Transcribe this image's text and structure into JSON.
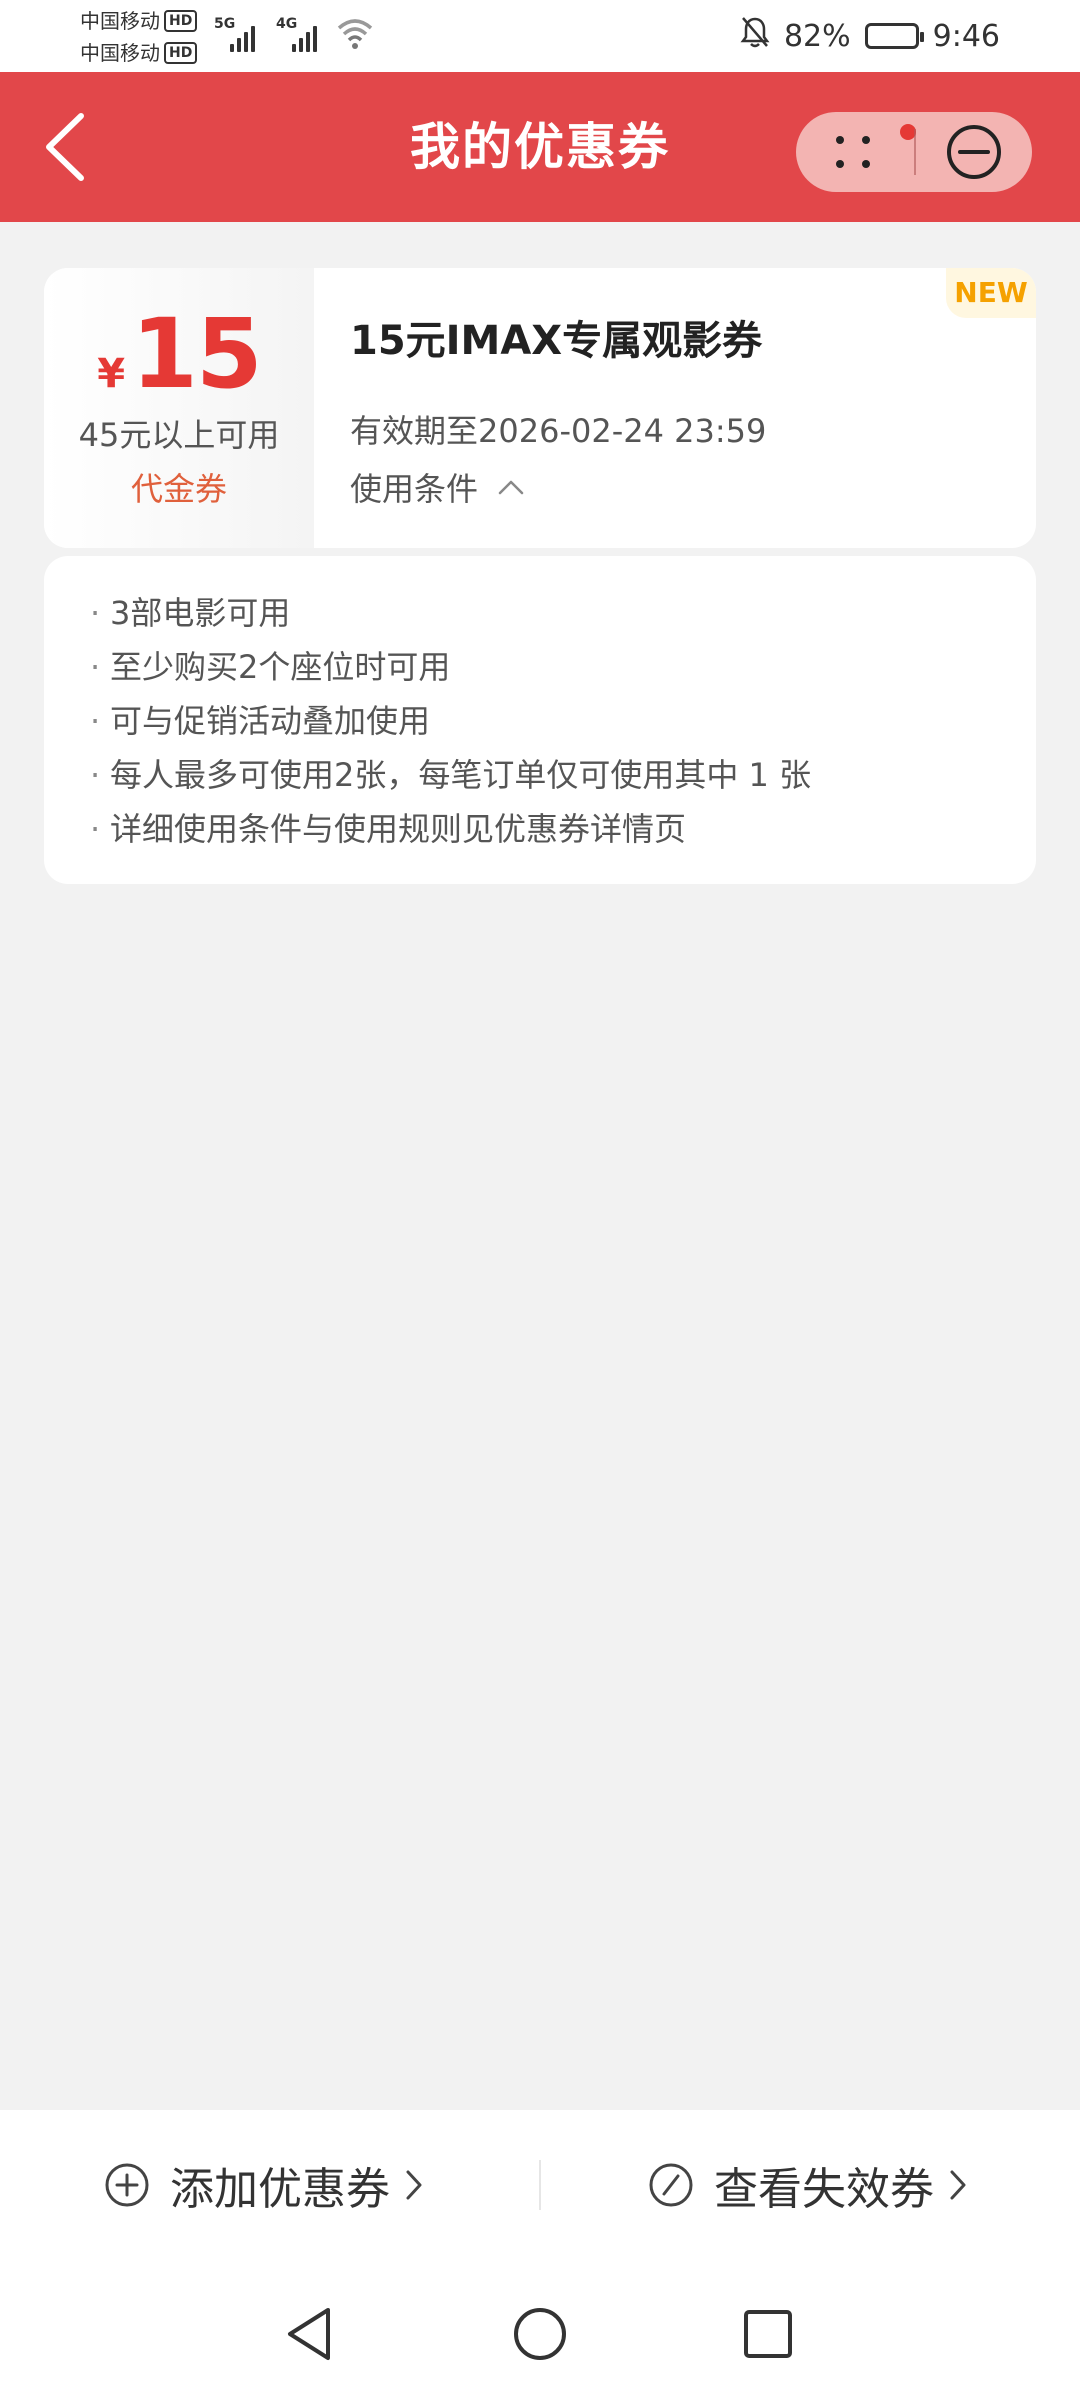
{
  "status_bar": {
    "carrier1": "中国移动",
    "carrier2": "中国移动",
    "hd_badge": "HD",
    "net1_label": "5G",
    "net2_label": "4G",
    "battery_percent": "82%",
    "battery_level": 0.82,
    "time": "9:46"
  },
  "header": {
    "title": "我的优惠券",
    "bg_color": "#e2474a"
  },
  "coupon": {
    "currency_symbol": "¥",
    "amount": "15",
    "min_spend": "45元以上可用",
    "type": "代金券",
    "name": "15元IMAX专属观影券",
    "expiry": "有效期至2026-02-24 23:59",
    "conditions_toggle": "使用条件",
    "badge": "NEW"
  },
  "conditions": {
    "bullet": "·",
    "items": [
      "3部电影可用",
      "至少购买2个座位时可用",
      "可与促销活动叠加使用",
      "每人最多可使用2张，每笔订单仅可使用其中 1 张",
      "详细使用条件与使用规则见优惠券详情页"
    ]
  },
  "bottom_bar": {
    "add_label": "添加优惠券",
    "expired_label": "查看失效券"
  },
  "icons": {
    "back": "chevron-left-icon",
    "more": "dots-icon",
    "close": "minus-circle-icon",
    "add": "plus-circle-icon",
    "expired": "slash-circle-icon",
    "chevron": "chevron-right-icon"
  }
}
